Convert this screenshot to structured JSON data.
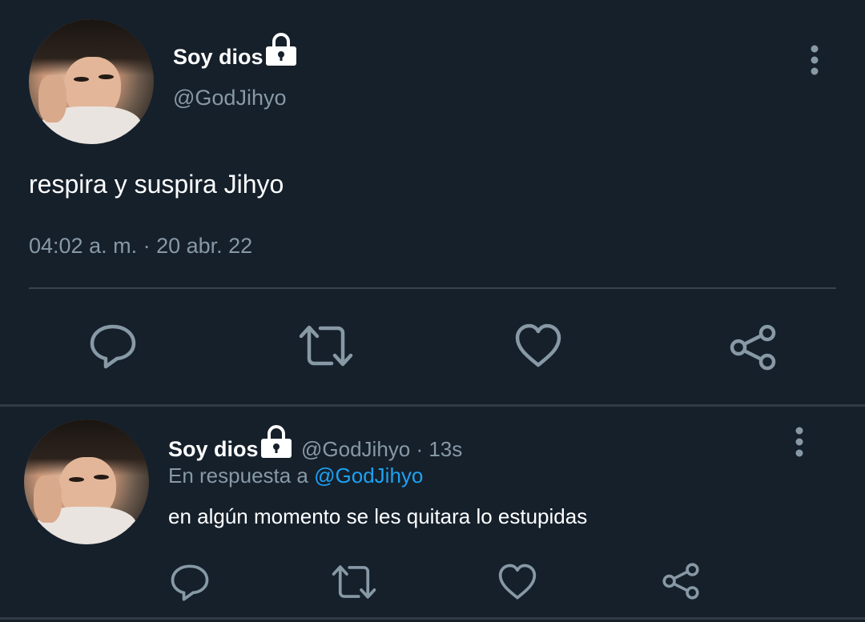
{
  "main_tweet": {
    "display_name": "Soy dios",
    "handle": "@GodJihyo",
    "text": "respira y suspira Jihyo",
    "timestamp": "04:02 a. m. · 20 abr. 22"
  },
  "reply_tweet": {
    "display_name": "Soy dios",
    "handle_time": "@GodJihyo · 13s",
    "reply_prefix": "En respuesta a",
    "reply_to": "@GodJihyo",
    "text": "en algún momento se les quitara lo estupidas"
  },
  "icons": [
    "lock-icon",
    "more-vertical-icon",
    "reply-icon",
    "retweet-icon",
    "like-icon",
    "share-icon"
  ],
  "colors": {
    "background": "#15202b",
    "muted": "#8899a6",
    "link": "#1da1f2",
    "divider": "#38444d"
  }
}
